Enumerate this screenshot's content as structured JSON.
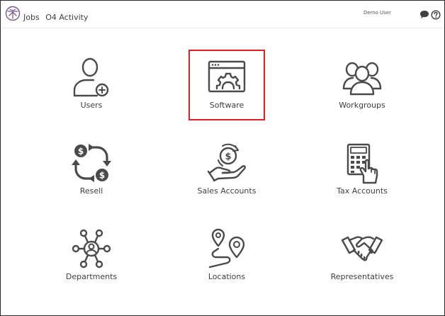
{
  "header": {
    "nav_jobs": "Jobs",
    "nav_activity": "O4 Activity",
    "user_name": "Demo User",
    "chat_icon": "chat-bubble-icon",
    "help_icon": "question-circle-icon",
    "logo_icon": "app-logo-icon"
  },
  "tiles": [
    {
      "label": "Users",
      "icon": "user-add-icon"
    },
    {
      "label": "Software",
      "icon": "software-gear-icon",
      "highlighted": true
    },
    {
      "label": "Workgroups",
      "icon": "group-icon"
    },
    {
      "label": "Resell",
      "icon": "dollar-cycle-icon"
    },
    {
      "label": "Sales Accounts",
      "icon": "hand-coin-icon"
    },
    {
      "label": "Tax Accounts",
      "icon": "calculator-hand-icon"
    },
    {
      "label": "Departments",
      "icon": "org-network-icon"
    },
    {
      "label": "Locations",
      "icon": "route-pins-icon"
    },
    {
      "label": "Representatives",
      "icon": "handshake-icon"
    }
  ],
  "colors": {
    "highlight": "#e02020",
    "icon": "#4a4a4a",
    "text": "#3f3f3f",
    "logo": "#7a5a8a"
  }
}
